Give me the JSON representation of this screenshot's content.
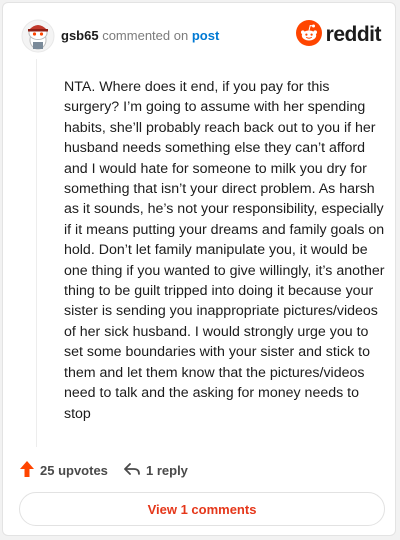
{
  "header": {
    "username": "gsb65",
    "commented_on": "commented on",
    "post_link": "post",
    "brand": "reddit"
  },
  "comment": {
    "text": "NTA. Where does it end, if you pay for this surgery? I’m going to assume with her spending habits, she’ll probably reach back out to you if her husband needs something else they can’t afford and I would hate for someone to milk you dry for something that isn’t your direct problem. As harsh as it sounds, he’s not your responsibility, especially if it means putting your dreams and family goals on hold. Don’t let family manipulate you, it would be one thing if you wanted to give willingly, it’s another thing to be guilt tripped into doing it because your sister is sending you inappropriate pictures/videos of her sick husband. I would strongly urge you to set some boundaries with your sister and stick to them and let them know that the pictures/videos need to talk and the asking for money needs to stop"
  },
  "actions": {
    "upvotes_label": "25 upvotes",
    "reply_label": "1 reply"
  },
  "view_comments_label": "View 1 comments",
  "icons": {
    "avatar": "snoo-avatar-icon",
    "brand": "reddit-logo-icon",
    "upvote": "upvote-arrow-icon",
    "reply": "reply-arrow-icon"
  },
  "colors": {
    "brand_orange": "#ff4500",
    "link_blue": "#0079d3",
    "button_text": "#e5371a"
  }
}
